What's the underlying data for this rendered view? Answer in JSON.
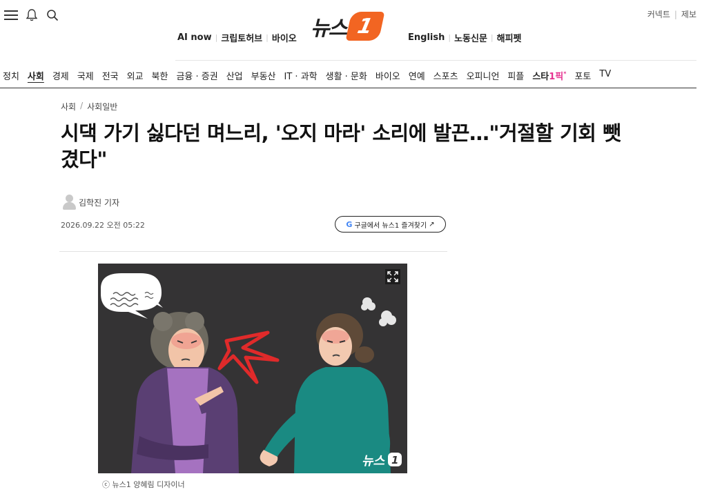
{
  "header": {
    "menu_icon": "hamburger-menu-icon",
    "bell_icon": "bell-icon",
    "search_icon": "search-icon",
    "logo_text": "뉴스",
    "logo_badge": "1",
    "links_left": [
      "AI now",
      "크립토허브",
      "바이오"
    ],
    "links_right": [
      "English",
      "노동신문",
      "해피펫"
    ],
    "top_right": [
      "커넥트",
      "제보"
    ]
  },
  "gnb": {
    "items": [
      "정치",
      "사회",
      "경제",
      "국제",
      "전국",
      "외교",
      "북한",
      "금융 · 증권",
      "산업",
      "부동산",
      "IT · 과학",
      "생활 · 문화",
      "바이오",
      "연예",
      "스포츠",
      "오피니언",
      "피플"
    ],
    "star_part1": "스타",
    "star_part2": "1픽",
    "star_mark": "*",
    "items_after": [
      "포토",
      "TV"
    ],
    "active": "사회"
  },
  "article": {
    "breadcrumb": [
      "사회",
      "사회일반"
    ],
    "breadcrumb_sep": "/",
    "headline": "시댁 가기 싫다던 며느리, '오지 마라' 소리에 발끈…\"거절할 기회 뺏겼다\"",
    "author": "김학진 기자",
    "date": "2026.09.22 오전 05:22",
    "google_button": "구글에서 뉴스1 즐겨찾기",
    "google_letter": "G",
    "google_arrow": "↗",
    "photo_watermark_text": "뉴스",
    "photo_watermark_badge": "1",
    "caption": "ⓒ 뉴스1 양혜림 디자이너"
  },
  "colors": {
    "brand_orange": "#f26522",
    "photo_bg": "#343334",
    "star_pink": "#e5318f"
  }
}
